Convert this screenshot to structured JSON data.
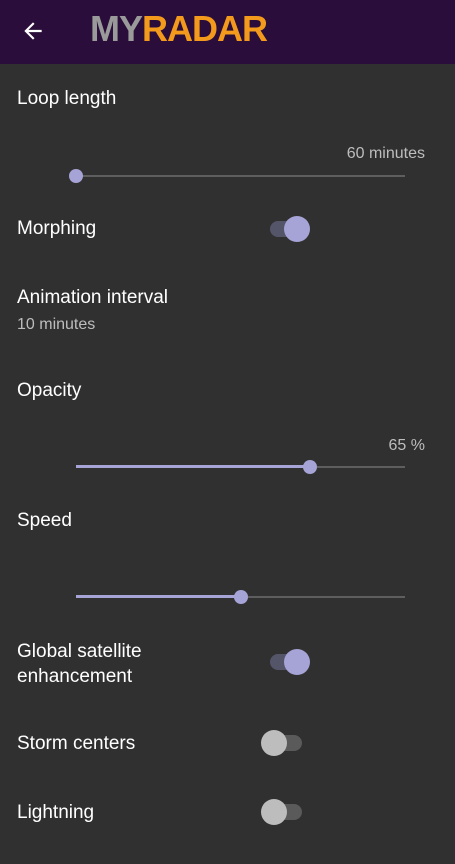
{
  "header": {
    "logo_my": "MY",
    "logo_radar": "RADAR",
    "back_icon": "arrow-left-icon",
    "background": "#2a0d3a"
  },
  "settings": {
    "loop_length": {
      "label": "Loop length",
      "value_text": "60 minutes",
      "level": 0.0
    },
    "morphing": {
      "label": "Morphing",
      "on": true
    },
    "animation_interval": {
      "label": "Animation interval",
      "value": "10 minutes"
    },
    "opacity": {
      "label": "Opacity",
      "value_text": "65 %",
      "level": 0.71
    },
    "speed": {
      "label": "Speed",
      "level": 0.5
    },
    "global_satellite": {
      "label_line1": "Global satellite",
      "label_line2": "enhancement",
      "on": true
    },
    "storm_centers": {
      "label": "Storm centers",
      "on": false
    },
    "lightning": {
      "label": "Lightning",
      "on": false
    }
  },
  "colors": {
    "accent": "#a6a3d6",
    "background": "#303030"
  }
}
